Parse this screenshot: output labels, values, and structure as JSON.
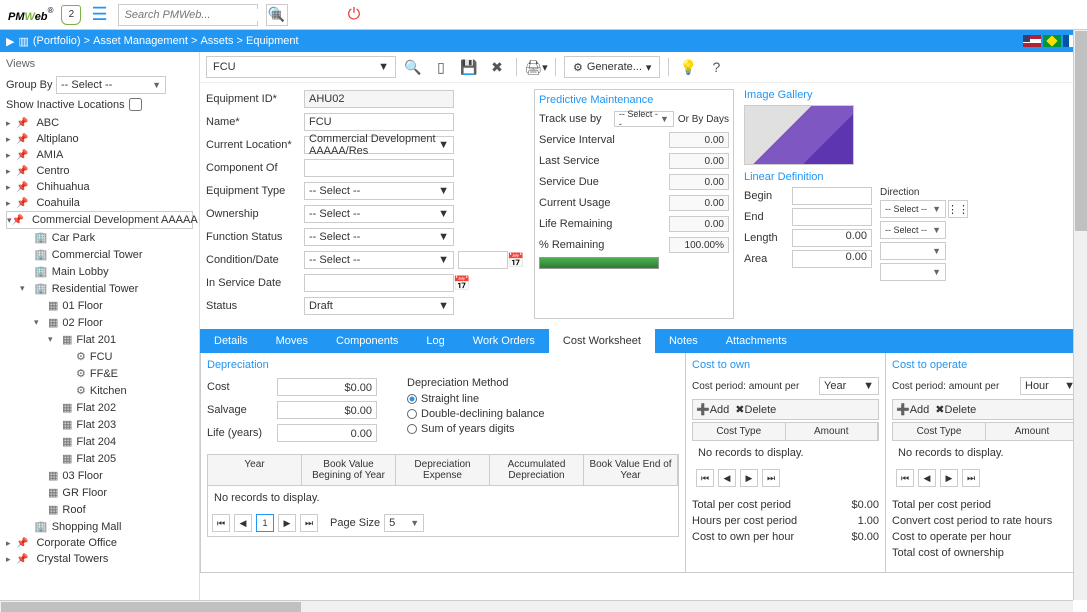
{
  "top": {
    "shield": "2",
    "search_ph": "Search PMWeb...",
    "generate": "Generate..."
  },
  "bc": {
    "portfolio": "(Portfolio)",
    "am": "Asset Management",
    "assets": "Assets",
    "equip": "Equipment"
  },
  "sidebar": {
    "views": "Views",
    "groupby": "Group By",
    "groupby_sel": "-- Select --",
    "show_inactive": "Show Inactive Locations",
    "items": [
      {
        "t": "ABC",
        "ind": 0,
        "arr": "▸"
      },
      {
        "t": "Altiplano",
        "ind": 0,
        "arr": "▸"
      },
      {
        "t": "AMIA",
        "ind": 0,
        "arr": "▸"
      },
      {
        "t": "Centro",
        "ind": 0,
        "arr": "▸"
      },
      {
        "t": "Chihuahua",
        "ind": 0,
        "arr": "▸"
      },
      {
        "t": "Coahuila",
        "ind": 0,
        "arr": "▸"
      },
      {
        "t": "Commercial Development AAAAA",
        "ind": 0,
        "arr": "▾",
        "sel": true
      },
      {
        "t": "Car Park",
        "ind": 1,
        "icon": "🏢"
      },
      {
        "t": "Commercial Tower",
        "ind": 1,
        "icon": "🏢"
      },
      {
        "t": "Main Lobby",
        "ind": 1,
        "icon": "🏢"
      },
      {
        "t": "Residential Tower",
        "ind": 1,
        "icon": "🏢",
        "arr": "▾"
      },
      {
        "t": "01 Floor",
        "ind": 2,
        "icon": "▦"
      },
      {
        "t": "02 Floor",
        "ind": 2,
        "icon": "▦",
        "arr": "▾"
      },
      {
        "t": "Flat 201",
        "ind": 3,
        "icon": "▦",
        "arr": "▾"
      },
      {
        "t": "FCU",
        "ind": 4,
        "icon": "⚙"
      },
      {
        "t": "FF&E",
        "ind": 4,
        "icon": "⚙"
      },
      {
        "t": "Kitchen",
        "ind": 4,
        "icon": "⚙"
      },
      {
        "t": "Flat 202",
        "ind": 3,
        "icon": "▦"
      },
      {
        "t": "Flat 203",
        "ind": 3,
        "icon": "▦"
      },
      {
        "t": "Flat 204",
        "ind": 3,
        "icon": "▦"
      },
      {
        "t": "Flat 205",
        "ind": 3,
        "icon": "▦"
      },
      {
        "t": "03 Floor",
        "ind": 2,
        "icon": "▦"
      },
      {
        "t": "GR Floor",
        "ind": 2,
        "icon": "▦"
      },
      {
        "t": "Roof",
        "ind": 2,
        "icon": "▦"
      },
      {
        "t": "Shopping Mall",
        "ind": 1,
        "icon": "🏢"
      },
      {
        "t": "Corporate Office",
        "ind": 0,
        "arr": "▸"
      },
      {
        "t": "Crystal Towers",
        "ind": 0,
        "arr": "▸"
      }
    ]
  },
  "name_sel": "FCU",
  "form": {
    "equipment_id": {
      "l": "Equipment ID",
      "v": "AHU02",
      "req": true
    },
    "name": {
      "l": "Name",
      "v": "FCU",
      "req": true
    },
    "location": {
      "l": "Current Location",
      "v": "Commercial Development AAAAA/Res",
      "req": true
    },
    "component_of": {
      "l": "Component Of",
      "v": ""
    },
    "equip_type": {
      "l": "Equipment Type",
      "v": "-- Select --"
    },
    "ownership": {
      "l": "Ownership",
      "v": "-- Select --"
    },
    "func_status": {
      "l": "Function Status",
      "v": "-- Select --"
    },
    "condition": {
      "l": "Condition/Date",
      "v": "-- Select --"
    },
    "in_service": {
      "l": "In Service Date",
      "v": ""
    },
    "status": {
      "l": "Status",
      "v": "Draft"
    }
  },
  "pm": {
    "hdr": "Predictive Maintenance",
    "track": "Track use by",
    "track_sel": "-- Select --",
    "or_days": "Or By Days",
    "rows": [
      {
        "l": "Service Interval",
        "v": "0.00"
      },
      {
        "l": "Last Service",
        "v": "0.00"
      },
      {
        "l": "Service Due",
        "v": "0.00"
      },
      {
        "l": "Current Usage",
        "v": "0.00"
      },
      {
        "l": "Life Remaining",
        "v": "0.00"
      },
      {
        "l": "% Remaining",
        "v": "100.00%"
      }
    ]
  },
  "gallery": {
    "hdr": "Image Gallery",
    "ld_hdr": "Linear Definition",
    "begin": "Begin",
    "end": "End",
    "length": "Length",
    "length_v": "0.00",
    "area": "Area",
    "area_v": "0.00",
    "direction": "Direction",
    "dir_sel": "-- Select --"
  },
  "tabs": [
    "Details",
    "Moves",
    "Components",
    "Log",
    "Work Orders",
    "Cost Worksheet",
    "Notes",
    "Attachments"
  ],
  "active_tab": "Cost Worksheet",
  "dep": {
    "hdr": "Depreciation",
    "cost": "Cost",
    "cost_v": "$0.00",
    "salvage": "Salvage",
    "salvage_v": "$0.00",
    "life": "Life (years)",
    "life_v": "0.00",
    "method": "Depreciation Method",
    "m1": "Straight line",
    "m2": "Double-declining balance",
    "m3": "Sum of years digits",
    "th": [
      "Year",
      "Book Value Begining of Year",
      "Depreciation Expense",
      "Accumulated Depreciation",
      "Book Value End of Year"
    ],
    "no_rec": "No records to display.",
    "page_size": "Page Size",
    "ps_v": "5",
    "pg": "1"
  },
  "own": {
    "hdr": "Cost to own",
    "cp": "Cost period: amount per",
    "cp_v": "Year",
    "add": "Add",
    "del": "Delete",
    "th": [
      "Cost Type",
      "Amount"
    ],
    "no_rec": "No records to display.",
    "sum": [
      {
        "l": "Total per cost period",
        "v": "$0.00"
      },
      {
        "l": "Hours per cost period",
        "v": "1.00"
      },
      {
        "l": "Cost to own per hour",
        "v": "$0.00"
      }
    ]
  },
  "op": {
    "hdr": "Cost to operate",
    "cp": "Cost period: amount per",
    "cp_v": "Hour",
    "add": "Add",
    "del": "Delete",
    "th": [
      "Cost Type",
      "Amount"
    ],
    "no_rec": "No records to display.",
    "sum": [
      {
        "l": "Total per cost period",
        "v": ""
      },
      {
        "l": "Convert cost period to rate hours",
        "v": ""
      },
      {
        "l": "Cost to operate per hour",
        "v": ""
      },
      {
        "l": "Total cost of ownership",
        "v": ""
      }
    ]
  }
}
